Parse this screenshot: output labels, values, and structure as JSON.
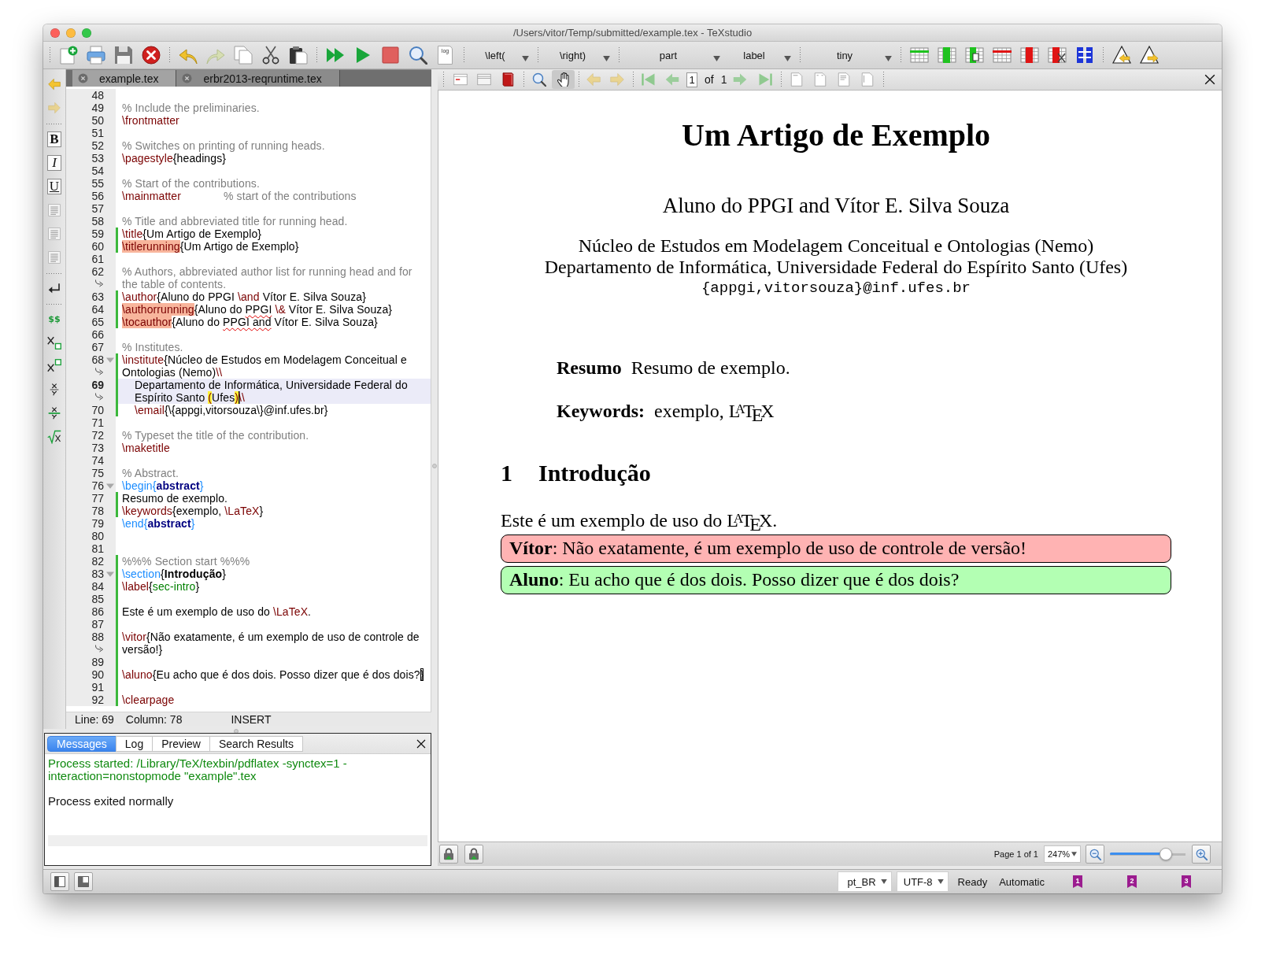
{
  "window": {
    "title": "/Users/vitor/Temp/submitted/example.tex - TeXstudio"
  },
  "toolbar": {
    "log_label": "log",
    "dropdowns": [
      {
        "value": "\\left("
      },
      {
        "value": "\\right)"
      },
      {
        "value": "part"
      },
      {
        "value": "label"
      },
      {
        "value": "tiny"
      }
    ]
  },
  "side_toolbar": {
    "format_buttons": [
      {
        "kind": "bold",
        "label": "B"
      },
      {
        "kind": "italic",
        "label": "I"
      },
      {
        "kind": "underline",
        "label": "U"
      }
    ],
    "math_button": "$$"
  },
  "editor": {
    "tabs": [
      {
        "label": "example.tex",
        "selected": true
      },
      {
        "label": "erbr2013-reqruntime.tex",
        "selected": false
      }
    ],
    "lines": [
      {
        "number": "48",
        "modified": false,
        "current": false,
        "fold": false
      },
      {
        "number": "49",
        "modified": false,
        "current": false,
        "fold": false,
        "rows": [
          [
            {
              "kind": "comment",
              "text": "% Include the preliminaries."
            }
          ]
        ]
      },
      {
        "number": "50",
        "modified": false,
        "current": false,
        "fold": false,
        "rows": [
          [
            {
              "kind": "command",
              "text": "\\frontmatter"
            }
          ]
        ]
      },
      {
        "number": "51",
        "modified": false,
        "current": false,
        "fold": false
      },
      {
        "number": "52",
        "modified": false,
        "current": false,
        "fold": false,
        "rows": [
          [
            {
              "kind": "comment",
              "text": "% Switches on printing of running heads."
            }
          ]
        ]
      },
      {
        "number": "53",
        "modified": false,
        "current": false,
        "fold": false,
        "rows": [
          [
            {
              "kind": "command",
              "text": "\\pagestyle"
            },
            {
              "kind": "plain",
              "text": "{headings}"
            }
          ]
        ]
      },
      {
        "number": "54",
        "modified": false,
        "current": false,
        "fold": false
      },
      {
        "number": "55",
        "modified": false,
        "current": false,
        "fold": false,
        "rows": [
          [
            {
              "kind": "comment",
              "text": "% Start of the contributions."
            }
          ]
        ]
      },
      {
        "number": "56",
        "modified": false,
        "current": false,
        "fold": false,
        "rows": [
          [
            {
              "kind": "command",
              "text": "\\mainmatter"
            },
            {
              "kind": "tabcomment",
              "text": "% start of the contributions"
            }
          ]
        ]
      },
      {
        "number": "57",
        "modified": false,
        "current": false,
        "fold": false
      },
      {
        "number": "58",
        "modified": false,
        "current": false,
        "fold": false,
        "rows": [
          [
            {
              "kind": "comment",
              "text": "% Title and abbreviated title for running head."
            }
          ]
        ]
      },
      {
        "number": "59",
        "modified": true,
        "current": false,
        "fold": false,
        "rows": [
          [
            {
              "kind": "command",
              "text": "\\title"
            },
            {
              "kind": "plain",
              "text": "{Um Artigo de Exemplo}"
            }
          ]
        ]
      },
      {
        "number": "60",
        "modified": true,
        "current": false,
        "fold": false,
        "rows": [
          [
            {
              "kind": "unknown",
              "text": "\\titlerunning"
            },
            {
              "kind": "plain",
              "text": "{Um Artigo de Exemplo}"
            }
          ]
        ]
      },
      {
        "number": "61",
        "modified": false,
        "current": false,
        "fold": false
      },
      {
        "number": "62",
        "modified": false,
        "current": false,
        "fold": false,
        "rows": [
          [
            {
              "kind": "comment",
              "text": "% Authors, abbreviated author list for running head and for"
            }
          ],
          [
            {
              "kind": "comment",
              "text": "the table of contents."
            }
          ]
        ]
      },
      {
        "number": "63",
        "modified": true,
        "current": false,
        "fold": false,
        "rows": [
          [
            {
              "kind": "command",
              "text": "\\author"
            },
            {
              "kind": "plain",
              "text": "{Aluno do PPGI "
            },
            {
              "kind": "command",
              "text": "\\and"
            },
            {
              "kind": "plain",
              "text": " Vítor E. Silva Souza}"
            }
          ]
        ]
      },
      {
        "number": "64",
        "modified": true,
        "current": false,
        "fold": false,
        "rows": [
          [
            {
              "kind": "unknown",
              "text": "\\authorrunning"
            },
            {
              "kind": "plain",
              "text": "{Aluno do "
            },
            {
              "kind": "misspelled",
              "text": "PPGI"
            },
            {
              "kind": "plain",
              "text": " "
            },
            {
              "kind": "command",
              "text": "\\&"
            },
            {
              "kind": "plain",
              "text": " Vítor E. Silva Souza}"
            }
          ]
        ]
      },
      {
        "number": "65",
        "modified": true,
        "current": false,
        "fold": false,
        "rows": [
          [
            {
              "kind": "unknown",
              "text": "\\tocauthor"
            },
            {
              "kind": "plain",
              "text": "{Aluno do "
            },
            {
              "kind": "misspelled",
              "text": "PPGI and"
            },
            {
              "kind": "plain",
              "text": " Vítor E. Silva Souza}"
            }
          ]
        ]
      },
      {
        "number": "66",
        "modified": false,
        "current": false,
        "fold": false
      },
      {
        "number": "67",
        "modified": false,
        "current": false,
        "fold": false,
        "rows": [
          [
            {
              "kind": "comment",
              "text": "% Institutes."
            }
          ]
        ]
      },
      {
        "number": "68",
        "modified": true,
        "current": false,
        "fold": true,
        "rows": [
          [
            {
              "kind": "command",
              "text": "\\institute"
            },
            {
              "kind": "plain",
              "text": "{Núcleo de Estudos em Modelagem Conceitual e"
            }
          ],
          [
            {
              "kind": "plain",
              "text": "Ontologias (Nemo)"
            },
            {
              "kind": "command",
              "text": "\\\\"
            }
          ]
        ]
      },
      {
        "number": "69",
        "modified": true,
        "current": true,
        "fold": false,
        "rows": [
          [
            {
              "kind": "plain",
              "text": "    Departamento de Informática, Universidade Federal do"
            }
          ],
          [
            {
              "kind": "plain",
              "text": "    Espírito Santo "
            },
            {
              "kind": "bracket",
              "text": "("
            },
            {
              "kind": "plain",
              "text": "Ufes"
            },
            {
              "kind": "caretbracket",
              "text": ")"
            },
            {
              "kind": "command",
              "text": "\\\\"
            }
          ]
        ]
      },
      {
        "number": "70",
        "modified": true,
        "current": false,
        "fold": false,
        "rows": [
          [
            {
              "kind": "command",
              "text": "    \\email"
            },
            {
              "kind": "plain",
              "text": "{\\{appgi,vitorsouza\\}@inf.ufes.br}"
            }
          ]
        ]
      },
      {
        "number": "71",
        "modified": false,
        "current": false,
        "fold": false
      },
      {
        "number": "72",
        "modified": false,
        "current": false,
        "fold": false,
        "rows": [
          [
            {
              "kind": "comment",
              "text": "% Typeset the title of the contribution."
            }
          ]
        ]
      },
      {
        "number": "73",
        "modified": false,
        "current": false,
        "fold": false,
        "rows": [
          [
            {
              "kind": "command",
              "text": "\\maketitle"
            }
          ]
        ]
      },
      {
        "number": "74",
        "modified": false,
        "current": false,
        "fold": false
      },
      {
        "number": "75",
        "modified": false,
        "current": false,
        "fold": false,
        "rows": [
          [
            {
              "kind": "comment",
              "text": "% Abstract."
            }
          ]
        ]
      },
      {
        "number": "76",
        "modified": false,
        "current": false,
        "fold": true,
        "rows": [
          [
            {
              "kind": "struct",
              "text": "\\begin{"
            },
            {
              "kind": "envname",
              "text": "abstract"
            },
            {
              "kind": "struct",
              "text": "}"
            }
          ]
        ]
      },
      {
        "number": "77",
        "modified": true,
        "current": false,
        "fold": false,
        "rows": [
          [
            {
              "kind": "plain",
              "text": "Resumo de exemplo."
            }
          ]
        ]
      },
      {
        "number": "78",
        "modified": true,
        "current": false,
        "fold": false,
        "rows": [
          [
            {
              "kind": "command",
              "text": "\\keywords"
            },
            {
              "kind": "plain",
              "text": "{exemplo, "
            },
            {
              "kind": "command",
              "text": "\\LaTeX"
            },
            {
              "kind": "plain",
              "text": "}"
            }
          ]
        ]
      },
      {
        "number": "79",
        "modified": false,
        "current": false,
        "fold": false,
        "rows": [
          [
            {
              "kind": "struct",
              "text": "\\end{"
            },
            {
              "kind": "envname",
              "text": "abstract"
            },
            {
              "kind": "struct",
              "text": "}"
            }
          ]
        ]
      },
      {
        "number": "80",
        "modified": false,
        "current": false,
        "fold": false
      },
      {
        "number": "81",
        "modified": false,
        "current": false,
        "fold": false
      },
      {
        "number": "82",
        "modified": true,
        "current": false,
        "fold": false,
        "rows": [
          [
            {
              "kind": "comment",
              "text": "%%% Section start %%%"
            }
          ]
        ]
      },
      {
        "number": "83",
        "modified": true,
        "current": false,
        "fold": true,
        "rows": [
          [
            {
              "kind": "struct",
              "text": "\\section"
            },
            {
              "kind": "plain",
              "text": "{"
            },
            {
              "kind": "bold",
              "text": "Introdução"
            },
            {
              "kind": "plain",
              "text": "}"
            }
          ]
        ]
      },
      {
        "number": "84",
        "modified": true,
        "current": false,
        "fold": false,
        "rows": [
          [
            {
              "kind": "command",
              "text": "\\label"
            },
            {
              "kind": "plain",
              "text": "{"
            },
            {
              "kind": "labelref",
              "text": "sec-intro"
            },
            {
              "kind": "plain",
              "text": "}"
            }
          ]
        ]
      },
      {
        "number": "85",
        "modified": true,
        "current": false,
        "fold": false
      },
      {
        "number": "86",
        "modified": true,
        "current": false,
        "fold": false,
        "rows": [
          [
            {
              "kind": "plain",
              "text": "Este é um exemplo de uso do "
            },
            {
              "kind": "command",
              "text": "\\LaTeX"
            },
            {
              "kind": "plain",
              "text": "."
            }
          ]
        ]
      },
      {
        "number": "87",
        "modified": true,
        "current": false,
        "fold": false
      },
      {
        "number": "88",
        "modified": true,
        "current": false,
        "fold": false,
        "rows": [
          [
            {
              "kind": "command",
              "text": "\\vitor"
            },
            {
              "kind": "plain",
              "text": "{Não exatamente, é um exemplo de uso de controle de"
            }
          ],
          [
            {
              "kind": "plain",
              "text": "versão!}"
            }
          ]
        ]
      },
      {
        "number": "89",
        "modified": true,
        "current": false,
        "fold": false
      },
      {
        "number": "90",
        "modified": true,
        "current": false,
        "fold": false,
        "rows": [
          [
            {
              "kind": "command",
              "text": "\\aluno"
            },
            {
              "kind": "plain",
              "text": "{Eu acho que é dos dois. Posso dizer que é dos dois?"
            },
            {
              "kind": "boxed",
              "text": "}"
            }
          ]
        ]
      },
      {
        "number": "91",
        "modified": true,
        "current": false,
        "fold": false
      },
      {
        "number": "92",
        "modified": true,
        "current": false,
        "fold": false,
        "rows": [
          [
            {
              "kind": "command",
              "text": "\\clearpage"
            }
          ]
        ]
      }
    ],
    "status": {
      "line": "Line: 69",
      "column": "Column: 78",
      "mode": "INSERT"
    }
  },
  "messages": {
    "tabs": [
      {
        "label": "Messages",
        "selected": true
      },
      {
        "label": "Log",
        "selected": false
      },
      {
        "label": "Preview",
        "selected": false
      },
      {
        "label": "Search Results",
        "selected": false
      }
    ],
    "entries": [
      {
        "kind": "process",
        "text": "Process started: /Library/TeX/texbin/pdflatex -synctex=1 -interaction=nonstopmode \"example\".tex"
      },
      {
        "kind": "plain",
        "text": "Process exited normally"
      }
    ]
  },
  "pdf_viewer": {
    "toolbar": {
      "page": "1",
      "of_label": "of",
      "page_count": "1"
    },
    "document": {
      "title": "Um Artigo de Exemplo",
      "authors": "Aluno do PPGI and Vítor E. Silva Souza",
      "affiliation": [
        "Núcleo de Estudos em Modelagem Conceitual e Ontologias (Nemo)",
        "Departamento de Informática, Universidade Federal do Espírito Santo (Ufes)"
      ],
      "email": "{appgi,vitorsouza}@inf.ufes.br",
      "abstract": {
        "label": "Resumo",
        "text": "Resumo de exemplo."
      },
      "keywords": {
        "label": "Keywords:",
        "text": "exemplo, L$^{A}$T$_{E}$X"
      },
      "section": {
        "number": "1",
        "title": "Introdução"
      },
      "body": "Este é um exemplo de uso do L$^{A}$T$_{E}$X.",
      "notes": [
        {
          "text": "**Vítor**: Não exatamente, é um exemplo de uso de controle de versão!",
          "color": "#ffb3b3"
        },
        {
          "text": "**Aluno**: Eu acho que é dos dois. Posso dizer que é dos dois?",
          "color": "#b3ffb3"
        }
      ]
    },
    "footer": {
      "page_info": "Page 1 of 1",
      "zoom": "247%",
      "zoom_slider": {
        "level": 0.74
      }
    }
  },
  "status_bar": {
    "language": "pt_BR",
    "encoding": "UTF-8",
    "state": "Ready",
    "mode": "Automatic",
    "bookmarks": [
      "1",
      "2",
      "3"
    ]
  }
}
